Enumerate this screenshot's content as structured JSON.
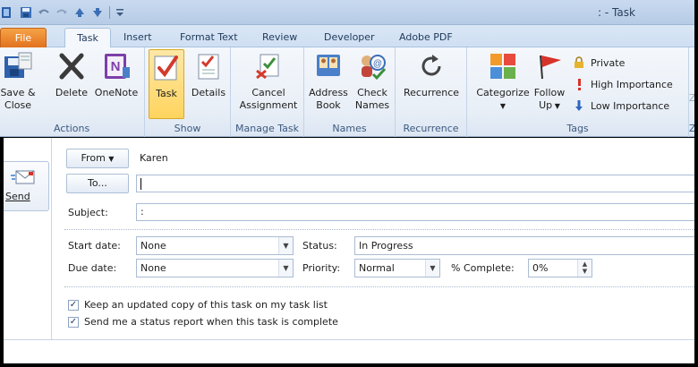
{
  "window": {
    "title": ": - Task"
  },
  "tabs": {
    "file": "File",
    "task": "Task",
    "insert": "Insert",
    "format_text": "Format Text",
    "review": "Review",
    "developer": "Developer",
    "adobe_pdf": "Adobe PDF"
  },
  "ribbon": {
    "actions": {
      "label": "Actions",
      "save_close_1": "Save &",
      "save_close_2": "Close",
      "delete": "Delete",
      "onenote": "OneNote"
    },
    "show": {
      "label": "Show",
      "task": "Task",
      "details": "Details"
    },
    "manage_task": {
      "label": "Manage Task",
      "cancel_1": "Cancel",
      "cancel_2": "Assignment"
    },
    "names": {
      "label": "Names",
      "address_1": "Address",
      "address_2": "Book",
      "check_1": "Check",
      "check_2": "Names"
    },
    "recurrence": {
      "label": "Recurrence",
      "recurrence": "Recurrence"
    },
    "tags": {
      "label": "Tags",
      "categorize": "Categorize",
      "follow_1": "Follow",
      "follow_2": "Up",
      "private": "Private",
      "high": "High Importance",
      "low": "Low Importance"
    },
    "zoom_partial": "Z"
  },
  "send": {
    "label": "Send"
  },
  "form": {
    "from_button": "From",
    "from_value": "Karen",
    "to_button": "To...",
    "to_value": "",
    "subject_label": "Subject:",
    "subject_value": ":",
    "start_date_label": "Start date:",
    "start_date_value": "None",
    "due_date_label": "Due date:",
    "due_date_value": "None",
    "status_label": "Status:",
    "status_value": "In Progress",
    "priority_label": "Priority:",
    "priority_value": "Normal",
    "complete_label": "% Complete:",
    "complete_value": "0%",
    "keep_copy": "Keep an updated copy of this task on my task list",
    "status_report": "Send me a status report when this task is complete"
  }
}
